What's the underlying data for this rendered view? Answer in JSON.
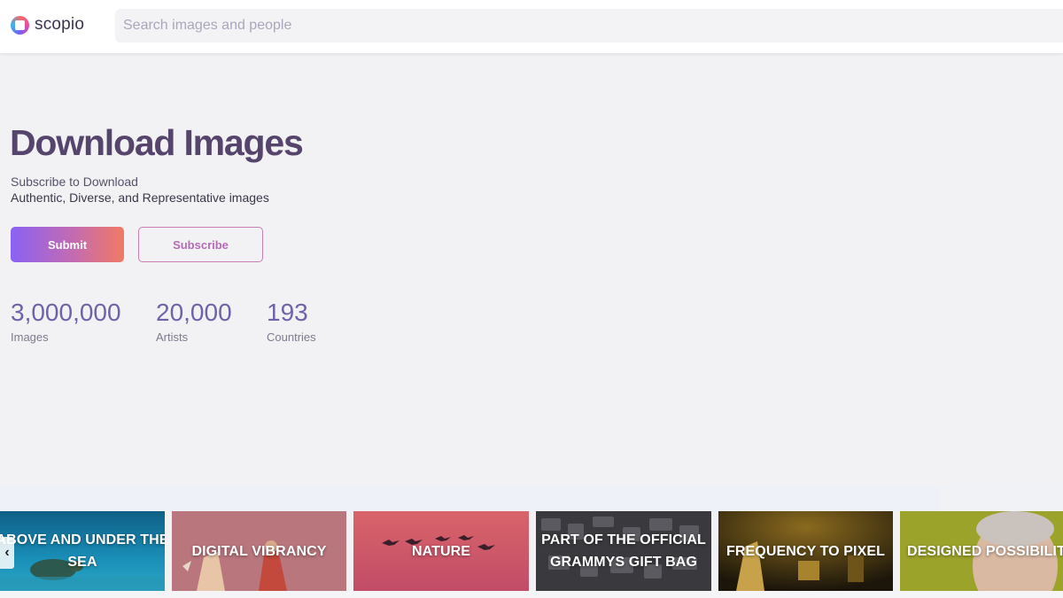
{
  "header": {
    "logo_text": "scopio",
    "search_placeholder": "Search images and people"
  },
  "hero": {
    "title": "Download Images",
    "subtitle_line1": "Subscribe to Download",
    "subtitle_line2": "Authentic, Diverse, and Representative images",
    "submit_label": "Submit",
    "subscribe_label": "Subscribe"
  },
  "stats": [
    {
      "value": "3,000,000",
      "label": "Images"
    },
    {
      "value": "20,000",
      "label": "Artists"
    },
    {
      "value": "193",
      "label": "Countries"
    }
  ],
  "categories": [
    {
      "label_line1": "ABOVE AND UNDER THE",
      "label_line2": "SEA",
      "color": "#1a7fa8"
    },
    {
      "label_line1": "DIGITAL VIBRANCY",
      "label_line2": "",
      "color": "#b8757c"
    },
    {
      "label_line1": "NATURE",
      "label_line2": "",
      "color": "#c9596b"
    },
    {
      "label_line1": "PART OF THE OFFICIAL",
      "label_line2": "GRAMMYS GIFT BAG",
      "color": "#3b3a3e"
    },
    {
      "label_line1": "FREQUENCY TO PIXEL",
      "label_line2": "",
      "color": "#2c2412"
    },
    {
      "label_line1": "DESIGNED POSSIBILITIES",
      "label_line2": "",
      "color": "#9aa22a"
    }
  ],
  "carousel": {
    "prev_icon": "chevron-left-icon"
  },
  "colors": {
    "brand_dark": "#55446b",
    "stat_value": "#6f63a8",
    "gradient_start": "#8a62f4",
    "gradient_end": "#f07a63"
  }
}
